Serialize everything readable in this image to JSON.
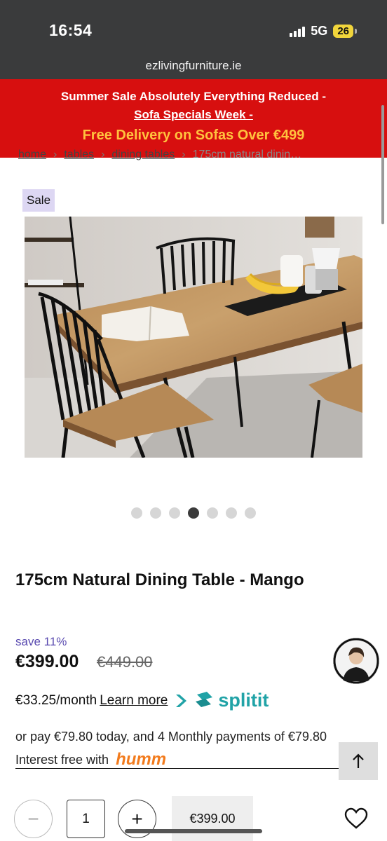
{
  "status_bar": {
    "time": "16:54",
    "network": "5G",
    "battery": "26"
  },
  "browser": {
    "url": "ezlivingfurniture.ie"
  },
  "banner": {
    "line1": "Summer Sale Absolutely Everything Reduced -",
    "line2": "Sofa Specials Week -",
    "line3": "Free Delivery on Sofas Over €499",
    "bg_color": "#d70f0f",
    "highlight_color": "#ffc23e"
  },
  "breadcrumb": {
    "items": [
      "home",
      "tables",
      "dining tables"
    ],
    "current": "175cm natural dinin…"
  },
  "product": {
    "badge": "Sale",
    "image_alt": "Dining table with black spindle chairs, bananas and book",
    "gallery_count": 7,
    "gallery_active_index": 3,
    "title": "175cm Natural Dining Table - Mango",
    "save_text": "save 11%",
    "price": "€399.00",
    "was_price": "€449.00"
  },
  "finance": {
    "monthly": "€33.25/month",
    "learn_more": "Learn more",
    "splitit_brand": "splitit",
    "humm_line1": "or pay €79.80 today, and 4 Monthly payments of €79.80",
    "humm_line2": "Interest free with",
    "humm_brand": "humm"
  },
  "cart": {
    "quantity": "1",
    "minus_symbol": "−",
    "plus_symbol": "+",
    "button_price": "€399.00"
  },
  "icons": {
    "back_to_top": "arrow-up-icon",
    "wishlist": "heart-icon",
    "chat": "chat-agent-avatar"
  }
}
